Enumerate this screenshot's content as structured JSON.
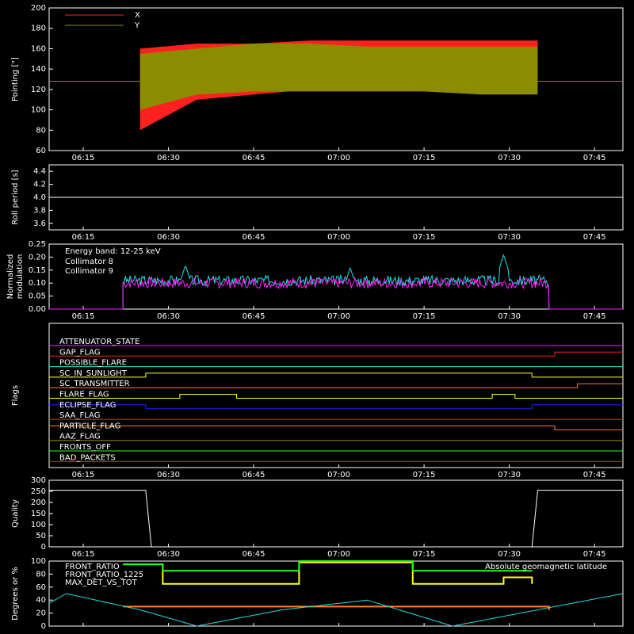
{
  "x_ticks": [
    "06:15",
    "06:30",
    "06:45",
    "07:00",
    "07:15",
    "07:30",
    "07:45"
  ],
  "colors": {
    "red": "#ff2020",
    "olive": "#8c8c00",
    "white": "#ffffff",
    "cyan": "#20e0e0",
    "magenta": "#ff20ff",
    "blue": "#2020ff",
    "yellow": "#ffff20",
    "orange": "#ff7f20",
    "green": "#20ff20"
  },
  "chart_data": [
    {
      "type": "line",
      "ylabel": "Pointing [\"]",
      "ylim": [
        60,
        200
      ],
      "yticks": [
        "60",
        "80",
        "100",
        "120",
        "140",
        "160",
        "180",
        "200"
      ],
      "legend": [
        "X",
        "Y"
      ],
      "series": [
        {
          "name": "X",
          "color": "red",
          "start": "06:25",
          "end": "07:35",
          "envelope": [
            [
              80,
              160
            ],
            [
              110,
              165
            ],
            [
              115,
              165
            ],
            [
              120,
              168
            ],
            [
              120,
              168
            ],
            [
              122,
              168
            ],
            [
              122,
              168
            ],
            [
              122,
              168
            ]
          ]
        },
        {
          "name": "Y",
          "color": "olive",
          "start": "06:25",
          "end": "07:35",
          "envelope": [
            [
              100,
              155
            ],
            [
              115,
              160
            ],
            [
              118,
              165
            ],
            [
              118,
              165
            ],
            [
              118,
              162
            ],
            [
              118,
              162
            ],
            [
              115,
              162
            ],
            [
              115,
              162
            ]
          ]
        }
      ],
      "reference_line": 128
    },
    {
      "type": "line",
      "ylabel": "Roll period [s]",
      "ylim": [
        3.5,
        4.5
      ],
      "yticks": [
        "3.6",
        "3.8",
        "4.0",
        "4.2",
        "4.4"
      ],
      "series": [
        {
          "name": "",
          "color": "white",
          "value": 4.0
        }
      ]
    },
    {
      "type": "line",
      "ylabel": "Normalized modulation",
      "ylim": [
        0,
        0.25
      ],
      "yticks": [
        "0.00",
        "0.05",
        "0.10",
        "0.15",
        "0.20",
        "0.25"
      ],
      "legend_title": "Energy band: 12-25 keV",
      "legend": [
        "Collimator 8",
        "Collimator 9"
      ],
      "series": [
        {
          "name": "Collimator 8",
          "color": "cyan",
          "start": "06:22",
          "end": "07:37",
          "base": 0.11,
          "peaks": [
            [
              "06:33",
              0.17
            ],
            [
              "07:02",
              0.16
            ],
            [
              "07:29",
              0.21
            ]
          ]
        },
        {
          "name": "Collimator 9",
          "color": "magenta",
          "start": "06:22",
          "end": "07:37",
          "base": 0.1,
          "peaks": []
        }
      ]
    },
    {
      "type": "line",
      "ylabel": "Flags",
      "flags": [
        {
          "name": "ATTENUATOR_STATE",
          "color": "magenta",
          "segments": [
            [
              0,
              0
            ]
          ]
        },
        {
          "name": "GAP_FLAG",
          "color": "red",
          "segments": [
            [
              0,
              0
            ],
            [
              "06:22",
              0
            ],
            [
              "07:38",
              1
            ]
          ]
        },
        {
          "name": "POSSIBLE_FLARE",
          "color": "cyan",
          "segments": [
            [
              0,
              0
            ]
          ]
        },
        {
          "name": "SC_IN_SUNLIGHT",
          "color": "yellow",
          "segments": [
            [
              0,
              0
            ],
            [
              "06:26",
              1
            ],
            [
              "07:34",
              0
            ]
          ]
        },
        {
          "name": "SC_TRANSMITTER",
          "color": "orange",
          "segments": [
            [
              0,
              0
            ],
            [
              "07:42",
              1
            ]
          ]
        },
        {
          "name": "FLARE_FLAG",
          "color": "yellow",
          "segments": [
            [
              0,
              0
            ],
            [
              "06:32",
              1
            ],
            [
              "06:42",
              0
            ],
            [
              "07:27",
              1
            ],
            [
              "07:31",
              0
            ]
          ]
        },
        {
          "name": "ECLIPSE_FLAG",
          "color": "blue",
          "segments": [
            [
              0,
              1
            ],
            [
              "06:26",
              0
            ],
            [
              "07:34",
              1
            ]
          ]
        },
        {
          "name": "SAA_FLAG",
          "color": "red",
          "segments": [
            [
              0,
              0
            ]
          ]
        },
        {
          "name": "PARTICLE_FLAG",
          "color": "orange",
          "segments": [
            [
              0,
              1
            ],
            [
              "07:38",
              0
            ]
          ]
        },
        {
          "name": "AAZ_FLAG",
          "color": "olive",
          "segments": [
            [
              0,
              0
            ]
          ]
        },
        {
          "name": "FRONTS_OFF",
          "color": "green",
          "segments": [
            [
              0,
              0
            ]
          ]
        },
        {
          "name": "BAD_PACKETS",
          "color": "red",
          "segments": [
            [
              0,
              0
            ]
          ]
        }
      ]
    },
    {
      "type": "line",
      "ylabel": "Quality",
      "ylim": [
        0,
        300
      ],
      "yticks": [
        "0",
        "50",
        "100",
        "150",
        "200",
        "250",
        "300"
      ],
      "series": [
        {
          "name": "",
          "color": "white",
          "points": [
            [
              "06:09",
              255
            ],
            [
              "06:26",
              255
            ],
            [
              "06:27",
              0
            ],
            [
              "07:34",
              0
            ],
            [
              "07:35",
              255
            ],
            [
              "07:50",
              255
            ]
          ]
        }
      ]
    },
    {
      "type": "line",
      "ylabel": "Degrees or %",
      "ylim": [
        0,
        100
      ],
      "yticks": [
        "0",
        "20",
        "40",
        "60",
        "80",
        "100"
      ],
      "legend": [
        "FRONT_RATIO",
        "FRONT_RATIO_1225",
        "MAX_DET_VS_TOT"
      ],
      "legend_right": "Absolute geomagnetic latitude",
      "series": [
        {
          "name": "FRONT_RATIO",
          "color": "yellow",
          "points": [
            [
              "06:22",
              95
            ],
            [
              "06:29",
              65
            ],
            [
              "06:52",
              65
            ],
            [
              "06:53",
              98
            ],
            [
              "07:12",
              98
            ],
            [
              "07:13",
              65
            ],
            [
              "07:27",
              65
            ],
            [
              "07:29",
              75
            ],
            [
              "07:34",
              65
            ]
          ]
        },
        {
          "name": "FRONT_RATIO_1225",
          "color": "green",
          "points": [
            [
              "06:22",
              95
            ],
            [
              "06:29",
              85
            ],
            [
              "06:52",
              85
            ],
            [
              "06:53",
              100
            ],
            [
              "07:12",
              100
            ],
            [
              "07:13",
              85
            ],
            [
              "07:34",
              85
            ]
          ]
        },
        {
          "name": "MAX_DET_VS_TOT",
          "color": "orange",
          "points": [
            [
              "06:22",
              30
            ],
            [
              "07:37",
              25
            ]
          ]
        },
        {
          "name": "Absolute geomagnetic latitude",
          "color": "cyan",
          "points": [
            [
              "06:09",
              35
            ],
            [
              "06:12",
              50
            ],
            [
              "06:25",
              25
            ],
            [
              "06:35",
              0
            ],
            [
              "06:50",
              25
            ],
            [
              "07:05",
              40
            ],
            [
              "07:20",
              0
            ],
            [
              "07:35",
              25
            ],
            [
              "07:50",
              50
            ]
          ]
        }
      ]
    }
  ]
}
